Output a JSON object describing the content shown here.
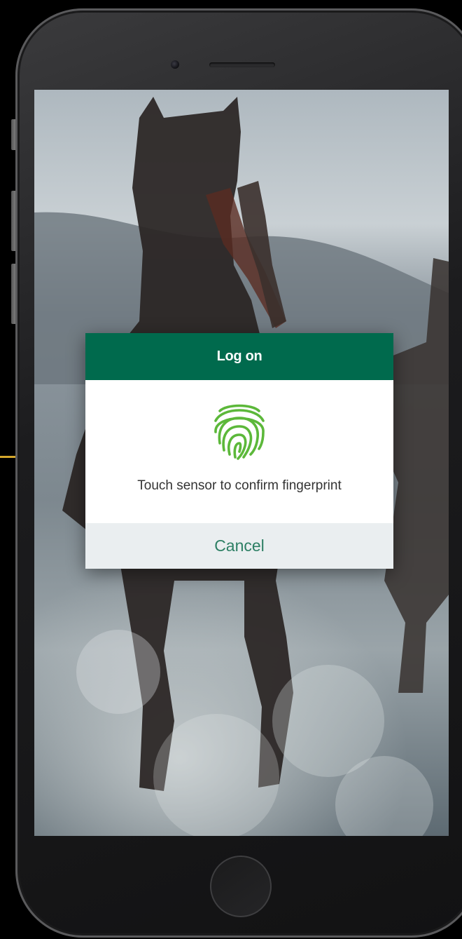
{
  "dialog": {
    "title": "Log on",
    "message": "Touch sensor to confirm fingerprint",
    "cancel_label": "Cancel",
    "icon": "fingerprint-icon"
  },
  "colors": {
    "header_green": "#006a4d",
    "fingerprint_green": "#5cb83a",
    "cancel_text": "#2d7f64",
    "footer_bg": "#eaeef0"
  },
  "background": {
    "subject": "horses-running-in-water-photo"
  }
}
